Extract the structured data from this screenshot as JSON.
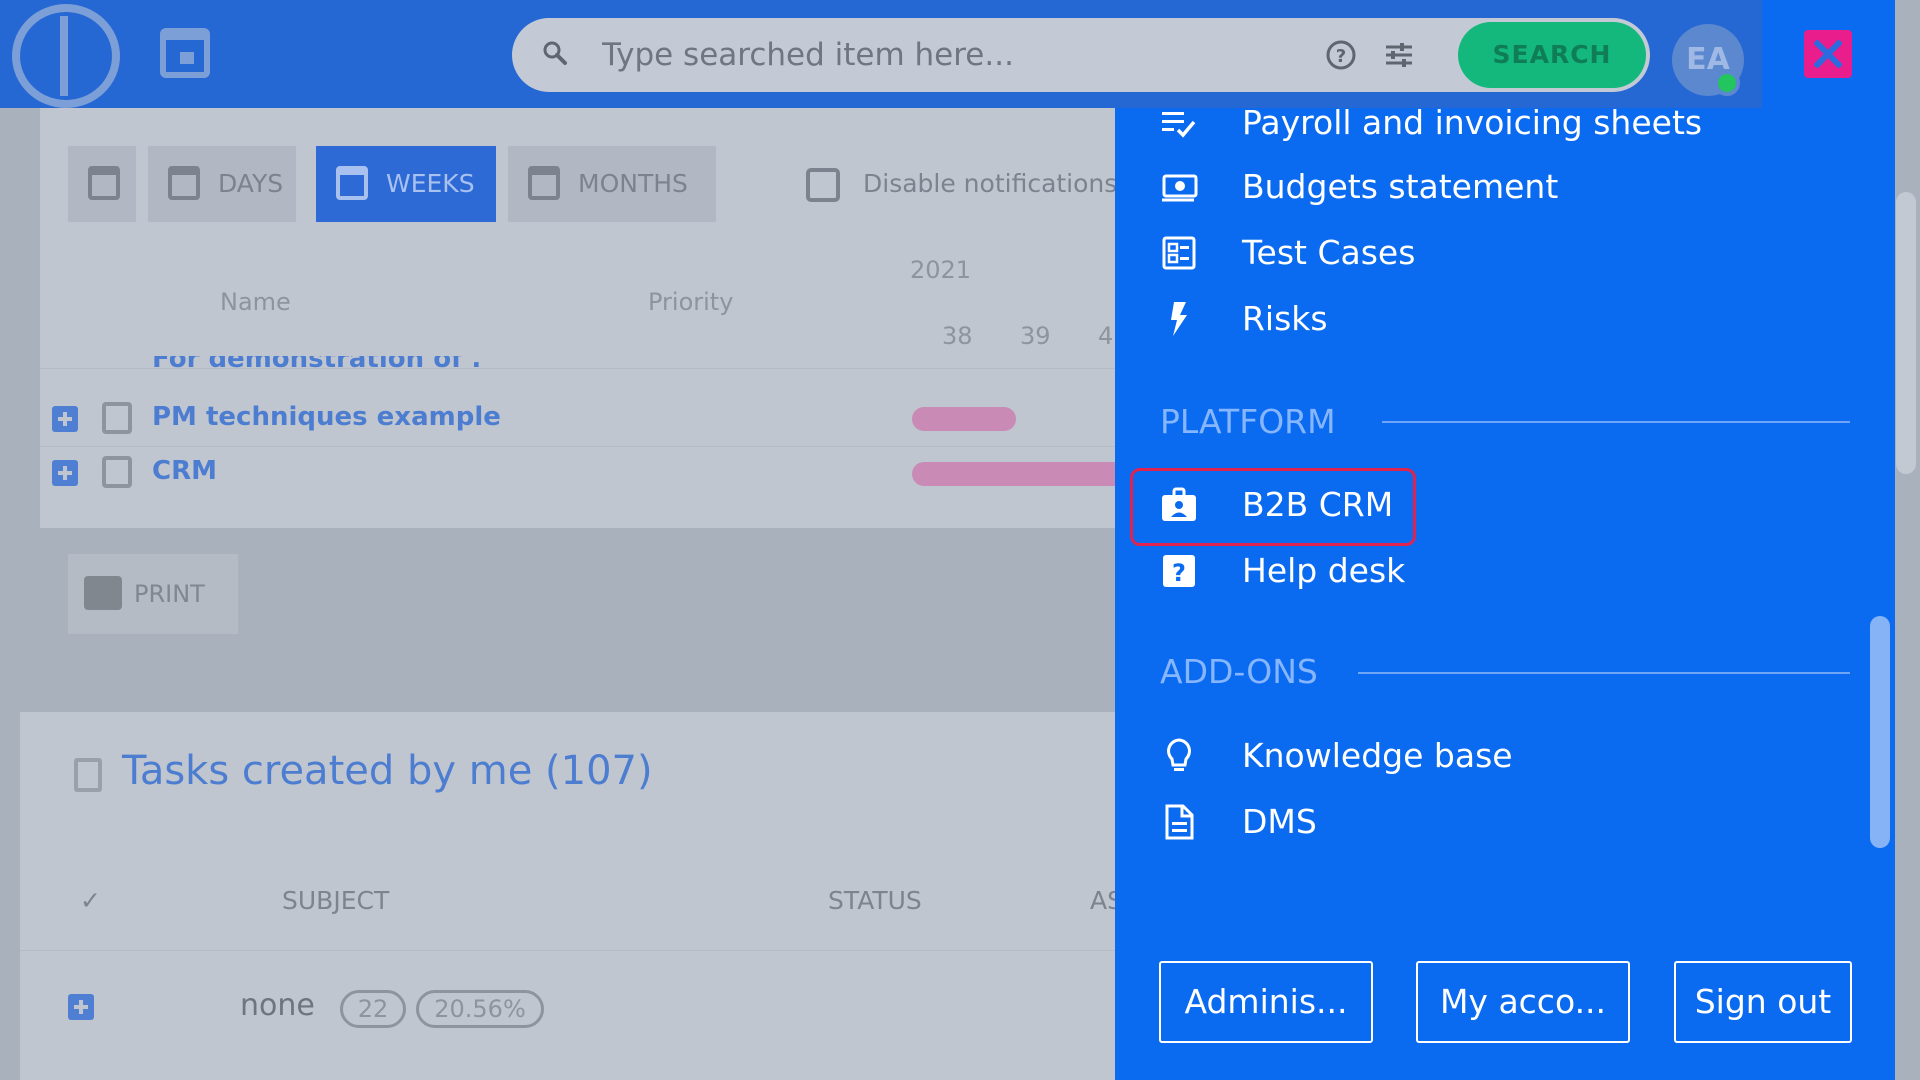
{
  "header": {
    "search_placeholder": "Type searched item here...",
    "search_button": "SEARCH",
    "avatar_initials": "EA"
  },
  "toolbar": {
    "days": "DAYS",
    "weeks": "WEEKS",
    "months": "MONTHS",
    "disable_notifications": "Disable notifications"
  },
  "gantt": {
    "name_header": "Name",
    "priority_header": "Priority",
    "year": "2021",
    "weeks": [
      "38",
      "39",
      "4"
    ],
    "rows": [
      {
        "name": "For demonstration of ..."
      },
      {
        "name": "PM techniques example"
      },
      {
        "name": "CRM"
      }
    ]
  },
  "print_label": "PRINT",
  "tasks": {
    "title": "Tasks created by me (107)",
    "check_col": "✓",
    "subject_col": "SUBJECT",
    "status_col": "STATUS",
    "extra_col": "AS",
    "group_label": "none",
    "group_count": "22",
    "group_percent": "20.56%"
  },
  "drawer": {
    "items_top": [
      {
        "label": "Payroll and invoicing sheets",
        "icon": "checklist-icon"
      },
      {
        "label": "Budgets statement",
        "icon": "money-icon"
      },
      {
        "label": "Test Cases",
        "icon": "test-cases-icon"
      },
      {
        "label": "Risks",
        "icon": "lightning-icon"
      }
    ],
    "platform_heading": "PLATFORM",
    "platform_items": [
      {
        "label": "B2B CRM",
        "icon": "contact-badge-icon"
      },
      {
        "label": "Help desk",
        "icon": "help-box-icon"
      }
    ],
    "addons_heading": "ADD-ONS",
    "addons_items": [
      {
        "label": "Knowledge base",
        "icon": "lightbulb-icon"
      },
      {
        "label": "DMS",
        "icon": "document-icon"
      }
    ],
    "buttons": {
      "administration": "Adminis...",
      "my_account": "My acco...",
      "sign_out": "Sign out"
    }
  },
  "colors": {
    "drawer_bg": "#0a6af0",
    "header_bg": "#2568d3",
    "highlight": "#e0244f",
    "close": "#e91e8c",
    "search_green": "#14b87d"
  }
}
